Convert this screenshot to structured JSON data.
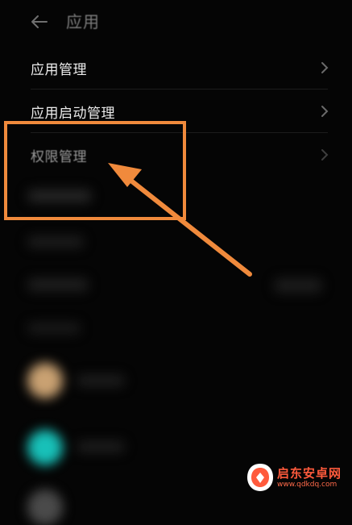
{
  "header": {
    "title": "应用",
    "back_icon": "arrow-left-icon"
  },
  "menu": [
    {
      "label": "应用管理",
      "icon": "chevron-right-icon"
    },
    {
      "label": "应用启动管理",
      "icon": "chevron-right-icon"
    },
    {
      "label": "权限管理",
      "icon": "chevron-right-icon"
    }
  ],
  "annotation": {
    "color": "#f08a3c"
  },
  "watermark": {
    "brand": "启东安卓网",
    "url": "www.qdkdq.com"
  }
}
